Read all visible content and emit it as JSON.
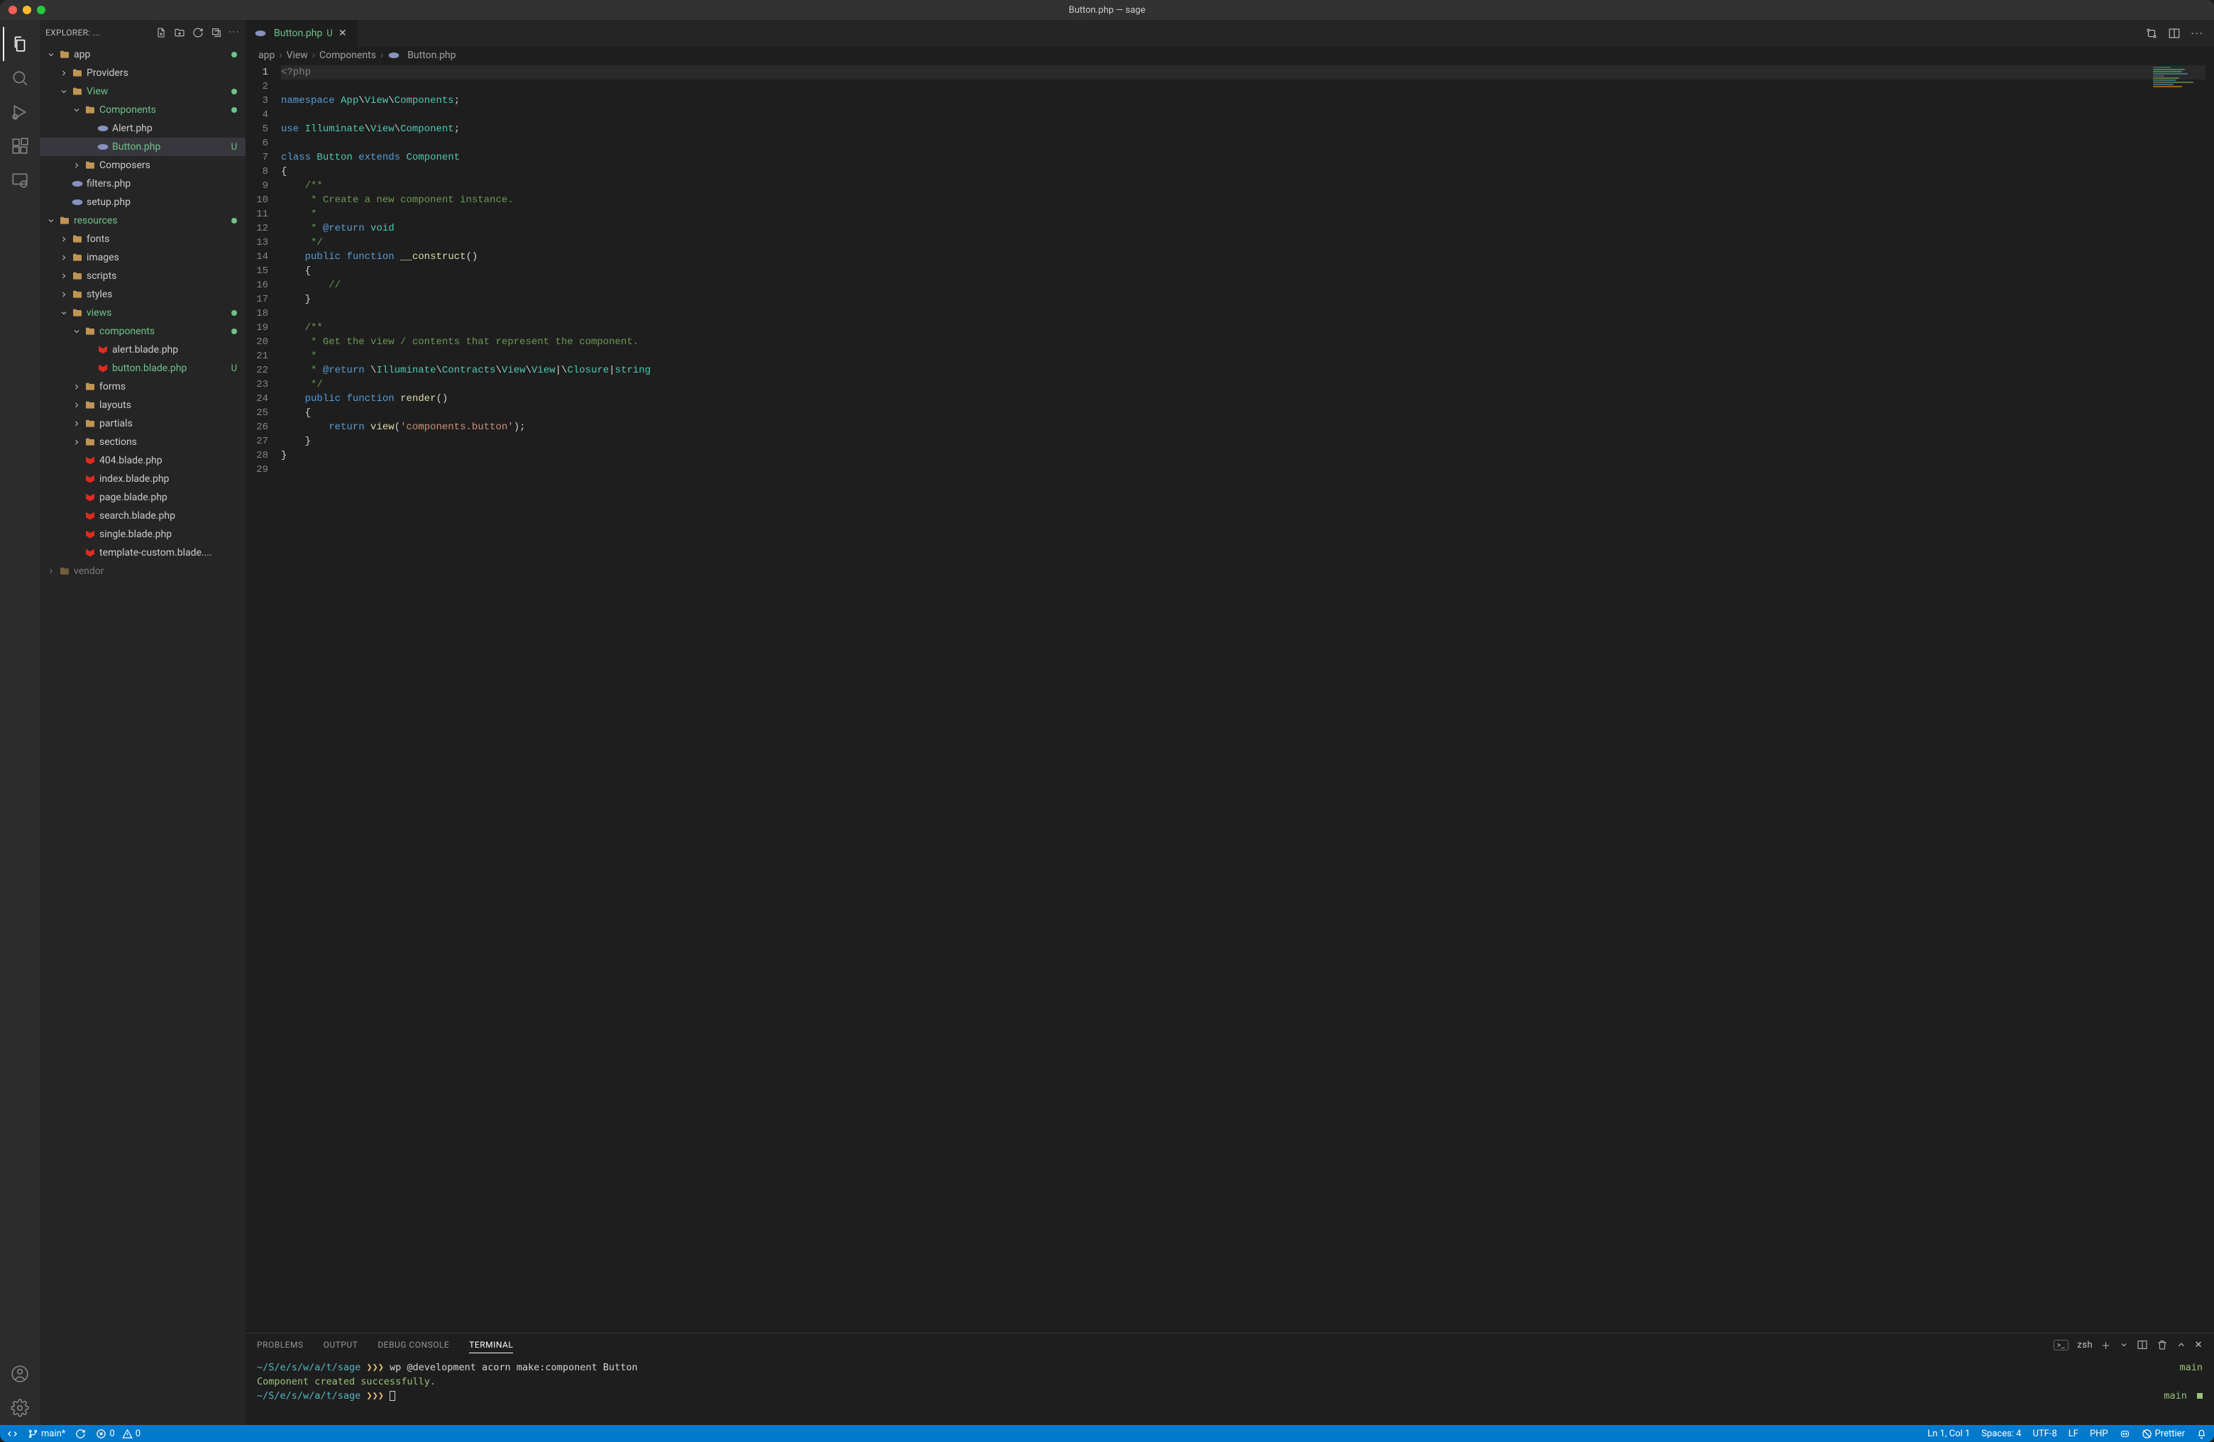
{
  "window": {
    "title": "Button.php — sage"
  },
  "explorer": {
    "label": "EXPLORER: ...",
    "tree": [
      {
        "d": 0,
        "type": "folder",
        "name": "app",
        "open": true,
        "modified": true
      },
      {
        "d": 1,
        "type": "folder",
        "name": "Providers",
        "open": false
      },
      {
        "d": 1,
        "type": "folder",
        "name": "View",
        "open": true,
        "class": "green",
        "modified": true
      },
      {
        "d": 2,
        "type": "folder",
        "name": "Components",
        "open": true,
        "class": "green",
        "modified": true
      },
      {
        "d": 3,
        "type": "php",
        "name": "Alert.php"
      },
      {
        "d": 3,
        "type": "php",
        "name": "Button.php",
        "class": "green",
        "git": "U",
        "selected": true
      },
      {
        "d": 2,
        "type": "folder",
        "name": "Composers",
        "open": false
      },
      {
        "d": 1,
        "type": "php",
        "name": "filters.php"
      },
      {
        "d": 1,
        "type": "php",
        "name": "setup.php"
      },
      {
        "d": 0,
        "type": "folder",
        "name": "resources",
        "open": true,
        "class": "green",
        "modified": true
      },
      {
        "d": 1,
        "type": "folder",
        "name": "fonts",
        "open": false
      },
      {
        "d": 1,
        "type": "folder",
        "name": "images",
        "open": false
      },
      {
        "d": 1,
        "type": "folder",
        "name": "scripts",
        "open": false
      },
      {
        "d": 1,
        "type": "folder",
        "name": "styles",
        "open": false
      },
      {
        "d": 1,
        "type": "folder",
        "name": "views",
        "open": true,
        "class": "green",
        "modified": true
      },
      {
        "d": 2,
        "type": "folder",
        "name": "components",
        "open": true,
        "class": "green",
        "modified": true
      },
      {
        "d": 3,
        "type": "blade",
        "name": "alert.blade.php"
      },
      {
        "d": 3,
        "type": "blade",
        "name": "button.blade.php",
        "class": "green",
        "git": "U"
      },
      {
        "d": 2,
        "type": "folder",
        "name": "forms",
        "open": false
      },
      {
        "d": 2,
        "type": "folder",
        "name": "layouts",
        "open": false
      },
      {
        "d": 2,
        "type": "folder",
        "name": "partials",
        "open": false
      },
      {
        "d": 2,
        "type": "folder",
        "name": "sections",
        "open": false
      },
      {
        "d": 2,
        "type": "blade",
        "name": "404.blade.php"
      },
      {
        "d": 2,
        "type": "blade",
        "name": "index.blade.php"
      },
      {
        "d": 2,
        "type": "blade",
        "name": "page.blade.php"
      },
      {
        "d": 2,
        "type": "blade",
        "name": "search.blade.php"
      },
      {
        "d": 2,
        "type": "blade",
        "name": "single.blade.php"
      },
      {
        "d": 2,
        "type": "blade",
        "name": "template-custom.blade...."
      },
      {
        "d": 0,
        "type": "folder",
        "name": "vendor",
        "open": false,
        "dim": true
      }
    ]
  },
  "tab": {
    "name": "Button.php",
    "git": "U"
  },
  "breadcrumb": [
    "app",
    "View",
    "Components",
    "Button.php"
  ],
  "code": {
    "lines": [
      {
        "n": 1,
        "cur": true,
        "html": "<span class='tk-proc'>&lt;?php</span>"
      },
      {
        "n": 2,
        "html": ""
      },
      {
        "n": 3,
        "html": "<span class='tk-kw'>namespace</span> <span class='tk-ns'>App</span>\\<span class='tk-ns'>View</span>\\<span class='tk-ns'>Components</span>;"
      },
      {
        "n": 4,
        "html": ""
      },
      {
        "n": 5,
        "html": "<span class='tk-kw'>use</span> <span class='tk-ns'>Illuminate</span>\\<span class='tk-ns'>View</span>\\<span class='tk-ns'>Component</span>;"
      },
      {
        "n": 6,
        "html": ""
      },
      {
        "n": 7,
        "html": "<span class='tk-kw'>class</span> <span class='tk-ns'>Button</span> <span class='tk-kw'>extends</span> <span class='tk-ns'>Component</span>"
      },
      {
        "n": 8,
        "html": "{"
      },
      {
        "n": 9,
        "html": "    <span class='tk-cmt'>/**</span>"
      },
      {
        "n": 10,
        "html": "    <span class='tk-cmt'> * Create a new component instance.</span>"
      },
      {
        "n": 11,
        "html": "    <span class='tk-cmt'> *</span>"
      },
      {
        "n": 12,
        "html": "    <span class='tk-cmt'> * </span><span class='tk-doc'>@return</span><span class='tk-cmt'> </span><span class='tk-ns'>void</span>"
      },
      {
        "n": 13,
        "html": "    <span class='tk-cmt'> */</span>"
      },
      {
        "n": 14,
        "html": "    <span class='tk-kw'>public</span> <span class='tk-kw'>function</span> <span class='tk-fn'>__construct</span>()"
      },
      {
        "n": 15,
        "html": "    {"
      },
      {
        "n": 16,
        "html": "        <span class='tk-cmt'>//</span>"
      },
      {
        "n": 17,
        "html": "    }"
      },
      {
        "n": 18,
        "html": ""
      },
      {
        "n": 19,
        "html": "    <span class='tk-cmt'>/**</span>"
      },
      {
        "n": 20,
        "html": "    <span class='tk-cmt'> * Get the view / contents that represent the component.</span>"
      },
      {
        "n": 21,
        "html": "    <span class='tk-cmt'> *</span>"
      },
      {
        "n": 22,
        "html": "    <span class='tk-cmt'> * </span><span class='tk-doc'>@return</span><span class='tk-cmt'> </span>\\<span class='tk-ns'>Illuminate</span>\\<span class='tk-ns'>Contracts</span>\\<span class='tk-ns'>View</span>\\<span class='tk-ns'>View</span>|\\<span class='tk-ns'>Closure</span>|<span class='tk-ns'>string</span>"
      },
      {
        "n": 23,
        "html": "    <span class='tk-cmt'> */</span>"
      },
      {
        "n": 24,
        "html": "    <span class='tk-kw'>public</span> <span class='tk-kw'>function</span> <span class='tk-fn'>render</span>()"
      },
      {
        "n": 25,
        "html": "    {"
      },
      {
        "n": 26,
        "html": "        <span class='tk-kw'>return</span> <span class='tk-fn'>view</span>(<span class='tk-str'>'components.button'</span>);"
      },
      {
        "n": 27,
        "html": "    }"
      },
      {
        "n": 28,
        "html": "}"
      },
      {
        "n": 29,
        "html": ""
      }
    ]
  },
  "panel": {
    "tabs": [
      "PROBLEMS",
      "OUTPUT",
      "DEBUG CONSOLE",
      "TERMINAL"
    ],
    "active": 3,
    "shell": "zsh",
    "terminal": {
      "path": "~/S/e/s/w/a/t/sage",
      "arrows": "❯❯❯",
      "cmd": "wp @development acorn make:component Button",
      "result": "Component created successfully.",
      "branch": "main"
    }
  },
  "status": {
    "remote_icon": "⎘",
    "branch": "main*",
    "errors": "0",
    "warnings": "0",
    "ln": "Ln 1, Col 1",
    "spaces": "Spaces: 4",
    "enc": "UTF-8",
    "eol": "LF",
    "lang": "PHP",
    "prettier": "Prettier"
  }
}
